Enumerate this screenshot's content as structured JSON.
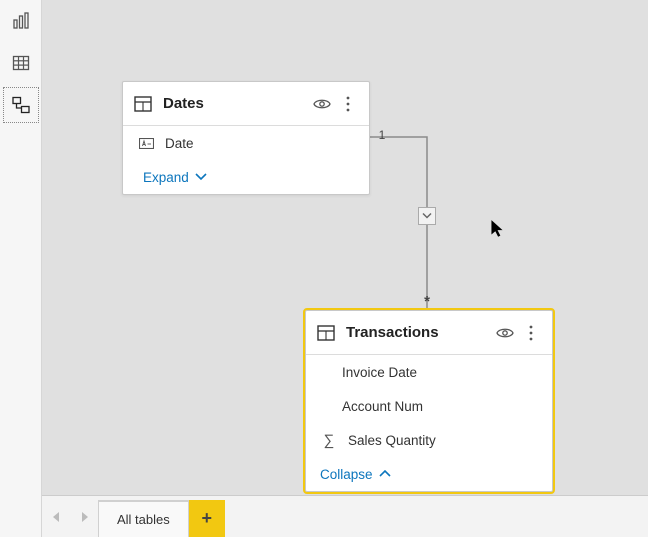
{
  "tables": {
    "dates": {
      "title": "Dates",
      "fields": {
        "date": "Date"
      },
      "toggle": "Expand"
    },
    "transactions": {
      "title": "Transactions",
      "fields": {
        "invoice_date": "Invoice Date",
        "account_num": "Account Num",
        "sales_qty": "Sales Quantity"
      },
      "toggle": "Collapse"
    }
  },
  "relationship": {
    "one": "1",
    "many": "*"
  },
  "footer": {
    "tab": "All tables",
    "add": "+"
  }
}
